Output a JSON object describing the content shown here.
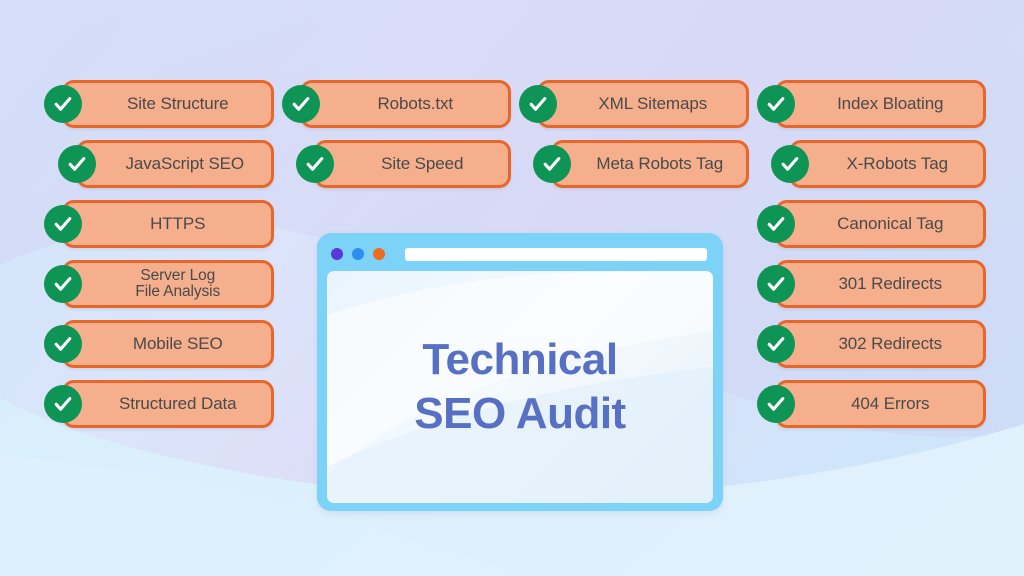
{
  "theme": {
    "pill_fill": "#F5AF8C",
    "pill_border": "#E8662A",
    "check_circle": "#0E9455",
    "check_mark": "#FFFFFF",
    "browser_frame": "#7DD3F7",
    "title_color": "#5870C4",
    "label_color": "#4A4A4A",
    "bg_blue": "#CFE6F9",
    "bg_lavender": "#D5D3F2"
  },
  "browser": {
    "dots": [
      {
        "name": "window-dot-purple",
        "color": "#5A37D8"
      },
      {
        "name": "window-dot-blue",
        "color": "#2B8FEF"
      },
      {
        "name": "window-dot-orange",
        "color": "#EE6A1E"
      }
    ],
    "address_bar_value": "",
    "title_line1": "Technical",
    "title_line2": "SEO Audit"
  },
  "columns": [
    {
      "id": "column-1",
      "items": [
        {
          "label": "Site Structure",
          "lines": 1,
          "icon": "check-circle-icon"
        },
        {
          "label": "JavaScript SEO",
          "lines": 1,
          "icon": "check-circle-icon"
        },
        {
          "label": "HTTPS",
          "lines": 1,
          "icon": "check-circle-icon"
        },
        {
          "label": "Server Log\nFile Analysis",
          "lines": 2,
          "icon": "check-circle-icon"
        },
        {
          "label": "Mobile SEO",
          "lines": 1,
          "icon": "check-circle-icon"
        },
        {
          "label": "Structured Data",
          "lines": 1,
          "icon": "check-circle-icon"
        }
      ]
    },
    {
      "id": "column-2",
      "items": [
        {
          "label": "Robots.txt",
          "lines": 1,
          "icon": "check-circle-icon"
        },
        {
          "label": "Site Speed",
          "lines": 1,
          "icon": "check-circle-icon"
        }
      ]
    },
    {
      "id": "column-3",
      "items": [
        {
          "label": "XML Sitemaps",
          "lines": 1,
          "icon": "check-circle-icon"
        },
        {
          "label": "Meta Robots Tag",
          "lines": 1,
          "icon": "check-circle-icon"
        }
      ]
    },
    {
      "id": "column-4",
      "items": [
        {
          "label": "Index Bloating",
          "lines": 1,
          "icon": "check-circle-icon"
        },
        {
          "label": "X-Robots Tag",
          "lines": 1,
          "icon": "check-circle-icon"
        },
        {
          "label": "Canonical Tag",
          "lines": 1,
          "icon": "check-circle-icon"
        },
        {
          "label": "301 Redirects",
          "lines": 1,
          "icon": "check-circle-icon"
        },
        {
          "label": "302 Redirects",
          "lines": 1,
          "icon": "check-circle-icon"
        },
        {
          "label": "404 Errors",
          "lines": 1,
          "icon": "check-circle-icon"
        }
      ]
    }
  ]
}
